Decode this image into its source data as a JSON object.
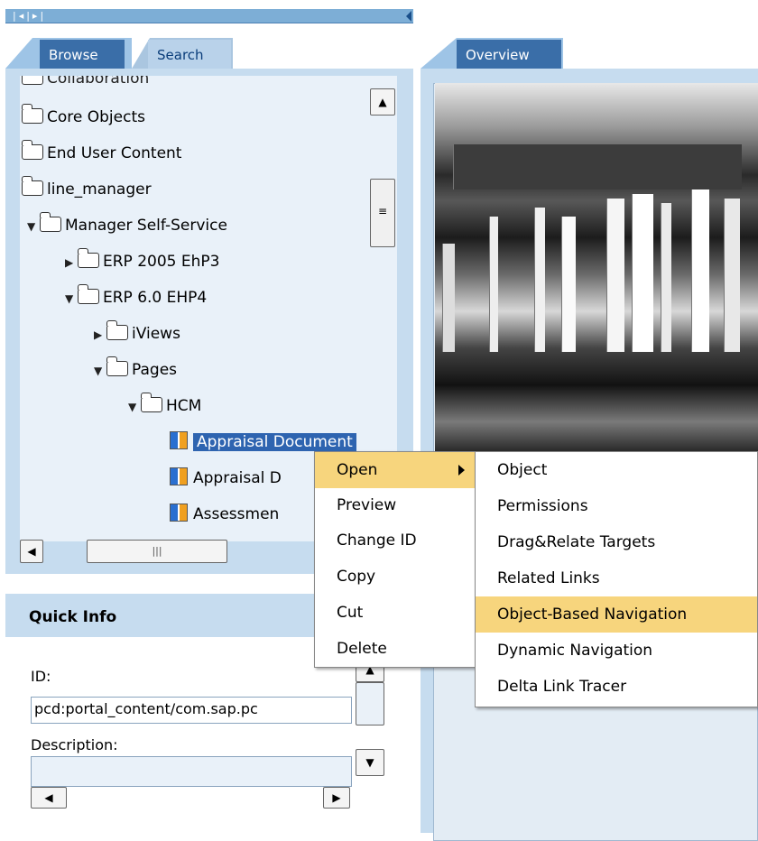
{
  "top_strip": {
    "nav": "|◂|▸|"
  },
  "tabs": {
    "browse": "Browse",
    "search": "Search",
    "overview": "Overview"
  },
  "tree": {
    "items": [
      {
        "label": "Collaboration"
      },
      {
        "label": "Core Objects"
      },
      {
        "label": "End User Content"
      },
      {
        "label": "line_manager"
      },
      {
        "label": "Manager Self-Service"
      },
      {
        "label": "ERP 2005 EhP3"
      },
      {
        "label": "ERP 6.0 EHP4"
      },
      {
        "label": "iViews"
      },
      {
        "label": "Pages"
      },
      {
        "label": "HCM"
      },
      {
        "label": "Appraisal Document"
      },
      {
        "label": "Appraisal D"
      },
      {
        "label": "Assessmen"
      }
    ]
  },
  "quick_info": {
    "title": "Quick Info",
    "id_label": "ID:",
    "id_value": "pcd:portal_content/com.sap.pc",
    "description_label": "Description:",
    "description_value": ""
  },
  "context_menu": {
    "items": [
      "Open",
      "Preview",
      "Change ID",
      "Copy",
      "Cut",
      "Delete"
    ],
    "submenu": [
      "Object",
      "Permissions",
      "Drag&Relate Targets",
      "Related Links",
      "Object-Based Navigation",
      "Dynamic Navigation",
      "Delta Link Tracer"
    ]
  },
  "colors": {
    "accent": "#2e64b0",
    "panel": "#c6dcef",
    "highlight": "#f7d57d"
  }
}
